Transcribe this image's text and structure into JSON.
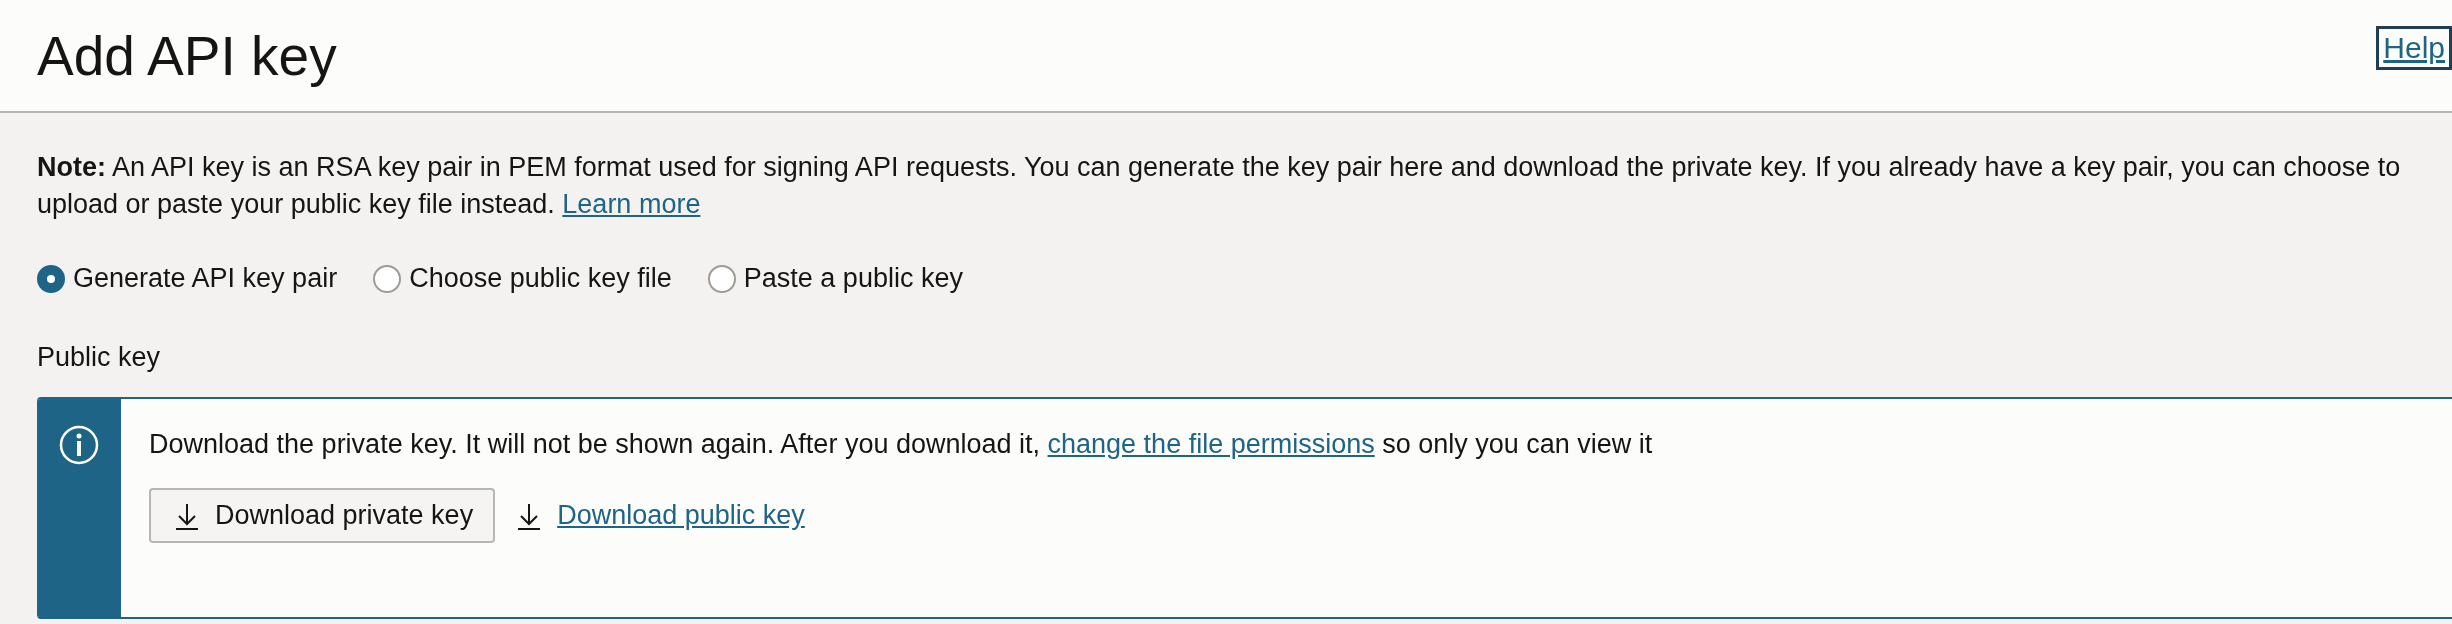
{
  "header": {
    "title": "Add API key",
    "help_link": "Help"
  },
  "note": {
    "text": "**Note:** An API key is an RSA key pair in PEM format used for signing API requests. You can generate the key pair here and download the private key. If you already have a key pair, you can choose to upload or paste your public key file instead.",
    "link": "Learn more"
  },
  "key_options": [
    {
      "label": "Generate API key pair",
      "selected": true
    },
    {
      "label": "Choose public key file",
      "selected": false
    },
    {
      "label": "Paste a public key",
      "selected": false
    }
  ],
  "public_key": {
    "label": "Public key",
    "info": {
      "text_before": "Download the private key. It will not be shown again. After you download it,",
      "link": "change the file permissions",
      "text_after": "so only you can view it"
    },
    "private_button": "Download private key",
    "public_link": "Download public key"
  }
}
